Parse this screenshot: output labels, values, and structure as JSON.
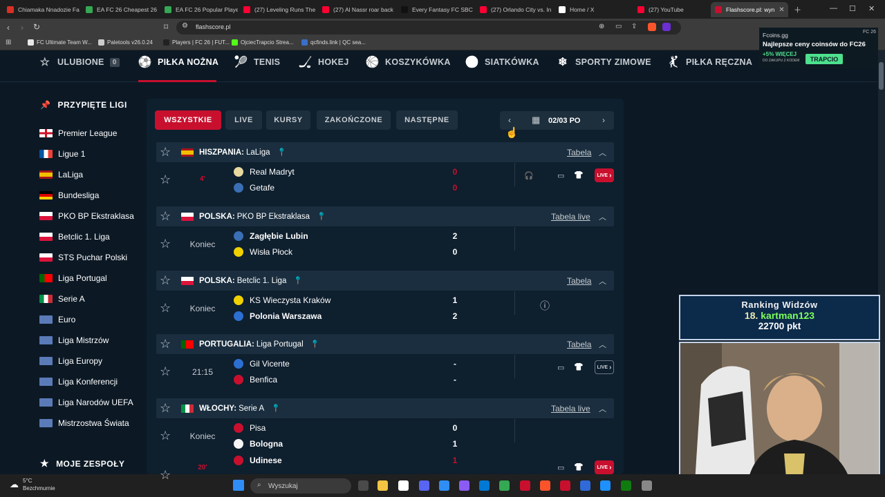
{
  "browser": {
    "tabs": [
      {
        "title": "Chiamaka Nnadozie Fa",
        "color": "#d93025"
      },
      {
        "title": "EA FC 26 Cheapest 26",
        "color": "#34a853"
      },
      {
        "title": "EA FC 26 Popular Playe",
        "color": "#34a853"
      },
      {
        "title": "(27) Leveling Runs The",
        "color": "#ff0033"
      },
      {
        "title": "(27) Al Nassr roar back",
        "color": "#ff0033"
      },
      {
        "title": "Every Fantasy FC SBC &",
        "color": "#111111"
      },
      {
        "title": "(27) Orlando City vs. In",
        "color": "#ff0033"
      },
      {
        "title": "Home / X",
        "color": "#ffffff"
      },
      {
        "title": "(27) YouTube",
        "color": "#ff0033"
      },
      {
        "title": "Flashscore.pl: wyn",
        "color": "#c8102e"
      }
    ],
    "url": "flashscore.pl",
    "bookmarks": [
      {
        "label": "FC Ultimate Team W...",
        "color": "#e8e8e8"
      },
      {
        "label": "Paletools v26.0.24",
        "color": "#cccccc"
      },
      {
        "label": "Players | FC 26 | FUT...",
        "color": "#222222"
      },
      {
        "label": "OjciecTrapcio Strea...",
        "color": "#53fc18"
      },
      {
        "label": "qcfinds.link | QC sea...",
        "color": "#3b6ec7"
      }
    ]
  },
  "nav": {
    "favorites": {
      "label": "ULUBIONE",
      "count": "0"
    },
    "sports": [
      "PIŁKA NOŻNA",
      "TENIS",
      "HOKEJ",
      "KOSZYKÓWKA",
      "SIATKÓWKA",
      "SPORTY ZIMOWE",
      "PIŁKA RĘCZNA"
    ]
  },
  "sidebar": {
    "pinned_title": "PRZYPIĘTE LIGI",
    "leagues": [
      {
        "name": "Premier League",
        "flag": "eng"
      },
      {
        "name": "Ligue 1",
        "flag": "fr"
      },
      {
        "name": "LaLiga",
        "flag": "es"
      },
      {
        "name": "Bundesliga",
        "flag": "de"
      },
      {
        "name": "PKO BP Ekstraklasa",
        "flag": "pl"
      },
      {
        "name": "Betclic 1. Liga",
        "flag": "pl"
      },
      {
        "name": "STS Puchar Polski",
        "flag": "pl"
      },
      {
        "name": "Liga Portugal",
        "flag": "pt"
      },
      {
        "name": "Serie A",
        "flag": "it"
      },
      {
        "name": "Euro",
        "flag": "eu"
      },
      {
        "name": "Liga Mistrzów",
        "flag": "eu"
      },
      {
        "name": "Liga Europy",
        "flag": "eu"
      },
      {
        "name": "Liga Konferencji",
        "flag": "eu"
      },
      {
        "name": "Liga Narodów UEFA",
        "flag": "eu"
      },
      {
        "name": "Mistrzostwa Świata",
        "flag": "eu"
      }
    ],
    "teams_title": "MOJE ZESPOŁY"
  },
  "filters": [
    "WSZYSTKIE",
    "LIVE",
    "KURSY",
    "ZAKOŃCZONE",
    "NASTĘPNE"
  ],
  "date": "02/03 PO",
  "leagues": [
    {
      "country": "HISZPANIA:",
      "league": "LaLiga",
      "table_label": "Tabela",
      "flag": "es",
      "matches": [
        {
          "status": "4'",
          "live": true,
          "home": "Real Madryt",
          "away": "Getafe",
          "home_score": "0",
          "away_score": "0"
        }
      ]
    },
    {
      "country": "POLSKA:",
      "league": "PKO BP Ekstraklasa",
      "table_label": "Tabela live",
      "flag": "pl",
      "matches": [
        {
          "status": "Koniec",
          "live": false,
          "home": "Zagłębie Lubin",
          "away": "Wisła Płock",
          "home_score": "2",
          "away_score": "0"
        }
      ]
    },
    {
      "country": "POLSKA:",
      "league": "Betclic 1. Liga",
      "table_label": "Tabela",
      "flag": "pl",
      "matches": [
        {
          "status": "Koniec",
          "live": false,
          "home": "KS Wieczysta Kraków",
          "away": "Polonia Warszawa",
          "home_score": "1",
          "away_score": "2"
        }
      ]
    },
    {
      "country": "PORTUGALIA:",
      "league": "Liga Portugal",
      "table_label": "Tabela",
      "flag": "pt",
      "matches": [
        {
          "status": "21:15",
          "live": false,
          "home": "Gil Vicente",
          "away": "Benfica",
          "home_score": "-",
          "away_score": "-"
        }
      ]
    },
    {
      "country": "WŁOCHY:",
      "league": "Serie A",
      "table_label": "Tabela live",
      "flag": "it",
      "matches": [
        {
          "status": "Koniec",
          "live": false,
          "home": "Pisa",
          "away": "Bologna",
          "home_score": "0",
          "away_score": "1"
        },
        {
          "status": "20'",
          "live": true,
          "home": "Udinese",
          "away": "",
          "home_score": "1",
          "away_score": ""
        }
      ]
    }
  ],
  "live_label": "LIVE",
  "ad": {
    "site": "Fcoins.gg",
    "headline": "Najlepsze ceny coinsów do FC26",
    "bonus": "+5% WIĘCEJ",
    "code_note": "DO ZAKUPU Z KODEM",
    "cta": "TRAPCIO",
    "tag": "FC 26"
  },
  "overlay": {
    "title": "Ranking Widzów",
    "rank": "18.",
    "user": "kartman123",
    "points": "22700 pkt"
  },
  "taskbar": {
    "temp": "5°C",
    "weather": "Bezchmurnie",
    "search": "Wyszukaj"
  },
  "colors": {
    "accent": "#c8102e",
    "background": "#0c1925",
    "panel": "#0e1f2e",
    "header_row": "#1a2e3f"
  }
}
